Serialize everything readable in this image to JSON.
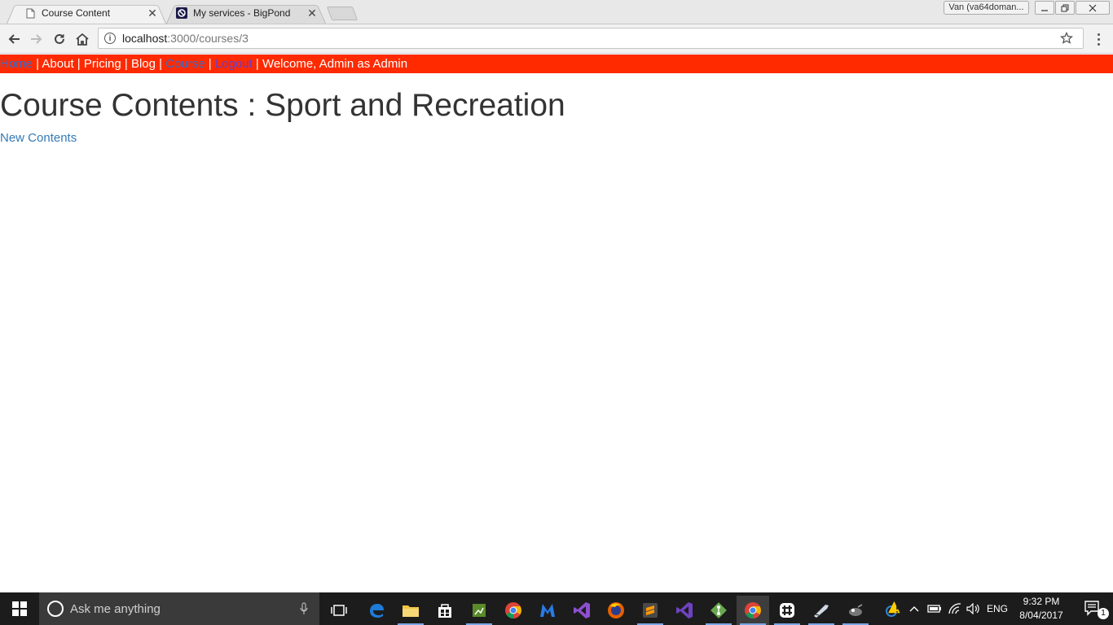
{
  "browser": {
    "tabs": [
      {
        "title": "Course Content",
        "active": true,
        "favicon": "page-icon"
      },
      {
        "title": "My services - BigPond",
        "active": false,
        "favicon": "bigpond-icon"
      }
    ],
    "profile_label": "Van (va64doman...",
    "url_host": "localhost",
    "url_path": ":3000/courses/3"
  },
  "navbar": {
    "home": "Home",
    "sep1": " | ",
    "about": "About",
    "sep2": " | ",
    "pricing": "Pricing",
    "sep3": " | ",
    "blog": "Blog",
    "sep4": " | ",
    "course": "Course",
    "sep5": " | ",
    "logout": "Logout",
    "sep6": " | ",
    "welcome": "Welcome, Admin as Admin",
    "bar_color": "#ff2a00"
  },
  "page": {
    "title": "Course Contents : Sport and Recreation",
    "new_contents_link": "New Contents"
  },
  "taskbar": {
    "search_placeholder": "Ask me anything",
    "language": "ENG",
    "time": "9:32 PM",
    "date": "8/04/2017",
    "notification_count": "1",
    "apps": [
      "task-view-icon",
      "edge-icon",
      "file-explorer-icon",
      "store-icon",
      "app-icon",
      "chrome-icon",
      "malwarebytes-icon",
      "visual-studio-icon",
      "firefox-icon",
      "sublime-icon",
      "visual-studio-icon",
      "git-icon",
      "chrome-icon",
      "slack-icon",
      "app-icon",
      "app-icon"
    ]
  }
}
